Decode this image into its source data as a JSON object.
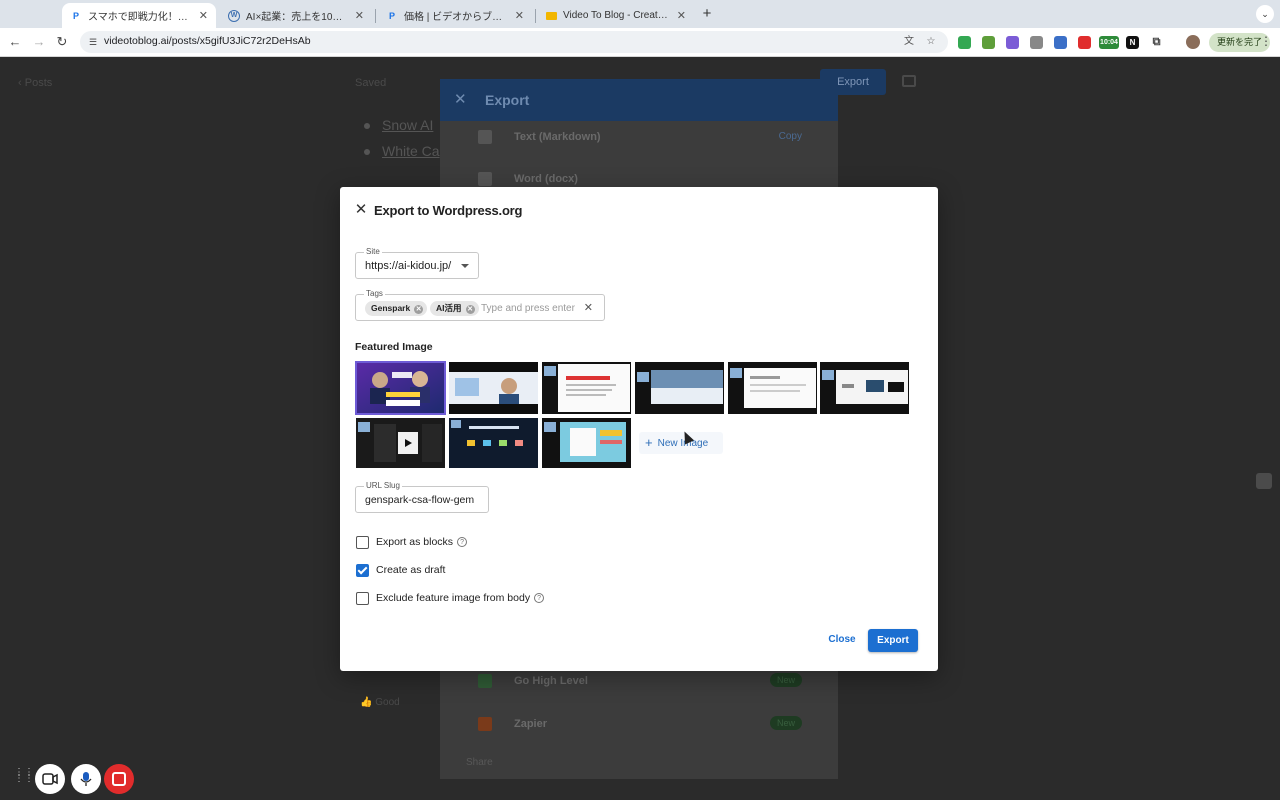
{
  "browser": {
    "tabs": [
      {
        "title": "スマホで即戦力化！Genspark©",
        "fav_color": "#1a73e8",
        "fav_glyph": "P",
        "active": true
      },
      {
        "title": "AI×起業：売上を10倍にするチ",
        "fav_color": "#3c6fb0",
        "fav_glyph": "W",
        "active": false
      },
      {
        "title": "価格 | ビデオからブログへ",
        "fav_color": "#1a73e8",
        "fav_glyph": "P",
        "active": false
      },
      {
        "title": "Video To Blog - Create quality",
        "fav_color": "#f2b600",
        "fav_glyph": "",
        "active": false
      }
    ],
    "url": "videotoblog.ai/posts/x5gifU3JiC72r2DeHsAb",
    "update_label": "更新を完了",
    "ext_clock": "10:04"
  },
  "background": {
    "back_label": "Posts",
    "saved_label": "Saved",
    "export_btn": "Export",
    "links": [
      "Snow AI",
      "White Ca"
    ],
    "good_label": "Good"
  },
  "export_panel": {
    "title": "Export",
    "rows": [
      {
        "label": "Text (Markdown)",
        "right": "Copy",
        "kind": "text"
      },
      {
        "label": "Word (docx)",
        "right": "",
        "kind": "text"
      },
      {
        "label": "Go High Level",
        "right": "New",
        "kind": "badge"
      },
      {
        "label": "Zapier",
        "right": "New",
        "kind": "badge"
      }
    ],
    "share_label": "Share"
  },
  "modal": {
    "title": "Export to Wordpress.org",
    "site": {
      "legend": "Site",
      "value": "https://ai-kidou.jp/"
    },
    "tags": {
      "legend": "Tags",
      "chips": [
        "Genspark",
        "AI活用"
      ],
      "placeholder": "Type and press enter"
    },
    "featured_label": "Featured Image",
    "new_image_label": "New Image",
    "slug": {
      "legend": "URL Slug",
      "value": "genspark-csa-flow-gem"
    },
    "checkboxes": [
      {
        "label": "Export as blocks",
        "checked": false,
        "help": true
      },
      {
        "label": "Create as draft",
        "checked": true,
        "help": false
      },
      {
        "label": "Exclude feature image from body",
        "checked": false,
        "help": true
      }
    ],
    "close_label": "Close",
    "export_label": "Export"
  },
  "colors": {
    "primary": "#1c6fd1",
    "selected_outline": "#6e5bd6",
    "record_red": "#e12c2c"
  }
}
